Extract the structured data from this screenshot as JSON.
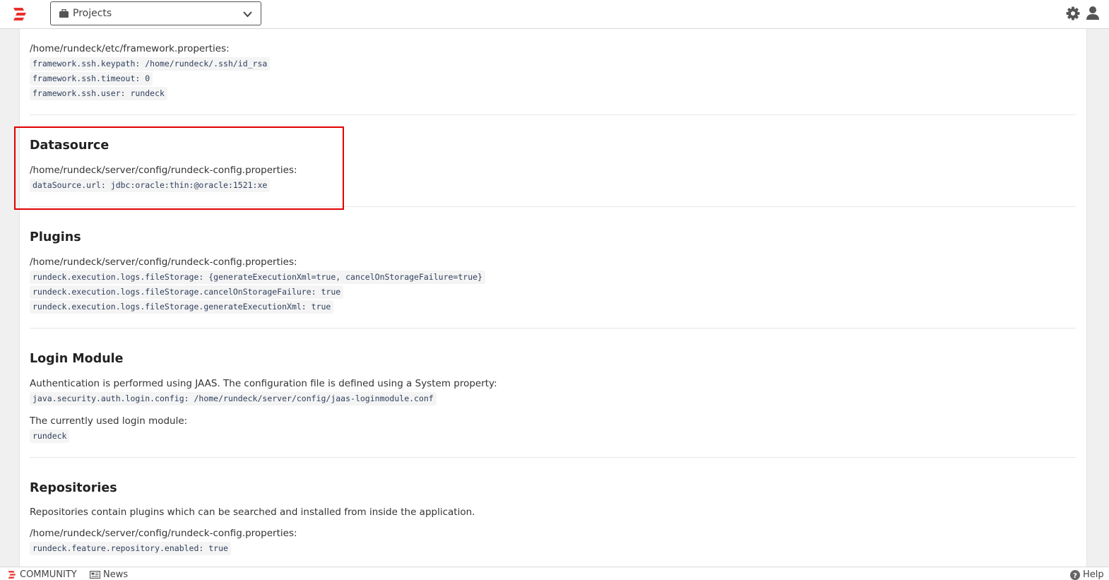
{
  "header": {
    "project_selector_label": "Projects",
    "icons": [
      "rundeck-logo",
      "briefcase-icon",
      "chevron-down-icon",
      "gear-icon",
      "user-icon"
    ]
  },
  "colors": {
    "accent_red": "#e00000",
    "logo_red": "#e8322c",
    "code_bg": "#f4f4f4",
    "code_text": "#2f3f5c"
  },
  "ssh": {
    "path": "/home/rundeck/etc/framework.properties:",
    "props": [
      "framework.ssh.keypath: /home/rundeck/.ssh/id_rsa",
      "framework.ssh.timeout: 0",
      "framework.ssh.user: rundeck"
    ]
  },
  "datasource": {
    "title": "Datasource",
    "path": "/home/rundeck/server/config/rundeck-config.properties:",
    "props": [
      "dataSource.url: jdbc:oracle:thin:@oracle:1521:xe"
    ]
  },
  "plugins": {
    "title": "Plugins",
    "path": "/home/rundeck/server/config/rundeck-config.properties:",
    "props": [
      "rundeck.execution.logs.fileStorage: {generateExecutionXml=true, cancelOnStorageFailure=true}",
      "rundeck.execution.logs.fileStorage.cancelOnStorageFailure: true",
      "rundeck.execution.logs.fileStorage.generateExecutionXml: true"
    ]
  },
  "login": {
    "title": "Login Module",
    "desc": "Authentication is performed using JAAS. The configuration file is defined using a System property:",
    "config_prop": "java.security.auth.login.config: /home/rundeck/server/config/jaas-loginmodule.conf",
    "current_label": "The currently used login module:",
    "current_value": "rundeck"
  },
  "repositories": {
    "title": "Repositories",
    "desc": "Repositories contain plugins which can be searched and installed from inside the application.",
    "path": "/home/rundeck/server/config/rundeck-config.properties:",
    "props": [
      "rundeck.feature.repository.enabled: true"
    ]
  },
  "footer": {
    "community": "COMMUNITY",
    "news": "News",
    "help": "Help"
  }
}
